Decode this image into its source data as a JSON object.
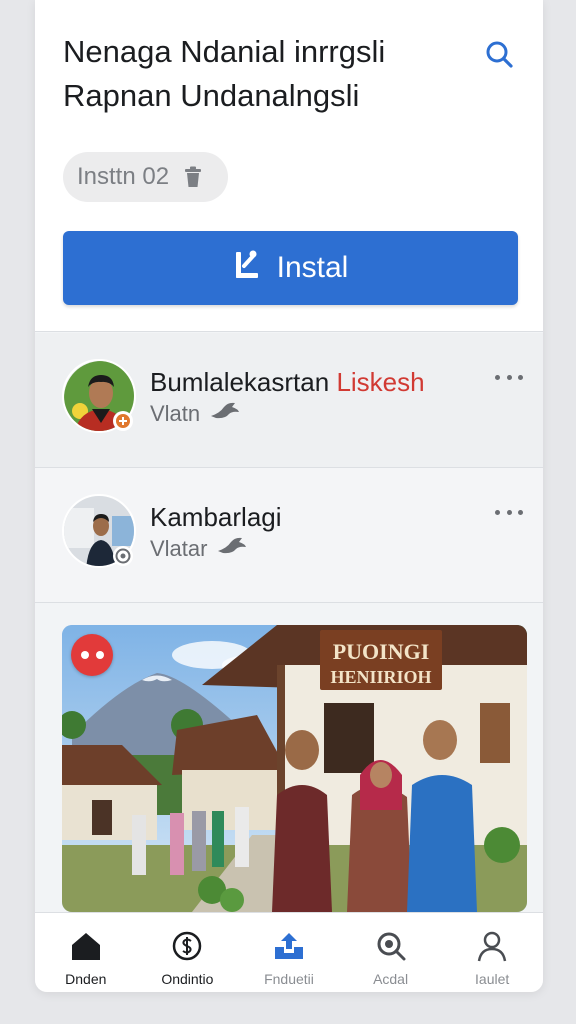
{
  "header": {
    "title_line1": "Nenaga Ndanial inrrgsli",
    "title_line2": "Rapnan Undanalngsli",
    "search_icon": "search-icon",
    "chip_label": "Insttn  02",
    "chip_icon": "trash-icon",
    "install_label": "Instal",
    "install_icon": "install-icon",
    "accent_color": "#2d6fd2"
  },
  "items": [
    {
      "name": "Bumlalekasrtan",
      "name_accent": "Liskesh",
      "sub": "Vlatn",
      "sub_icon": "bird-icon",
      "more_icon": "more-icon"
    },
    {
      "name": "Kambarlagi",
      "sub": "Vlatar",
      "sub_icon": "bird-icon",
      "more_icon": "more-icon"
    }
  ],
  "photo": {
    "sign_line1": "PUOINGI",
    "sign_line2": "HENIIRIOH",
    "menu_icon": "more-dots-icon"
  },
  "nav": [
    {
      "label": "Dnden",
      "icon": "home-icon"
    },
    {
      "label": "Ondintio",
      "icon": "currency-icon"
    },
    {
      "label": "Fnduetii",
      "icon": "upload-icon"
    },
    {
      "label": "Acdal",
      "icon": "search-icon"
    },
    {
      "label": "Iaulet",
      "icon": "profile-icon"
    }
  ]
}
